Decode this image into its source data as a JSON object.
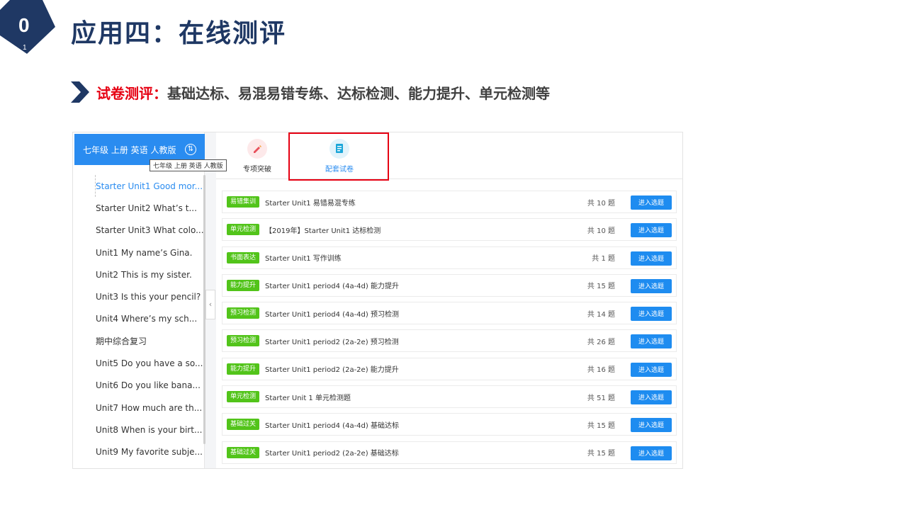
{
  "slide": {
    "badge_number": "0",
    "badge_sub": "1",
    "title": "应用四：在线测评",
    "subtitle_lead": "试卷测评：",
    "subtitle_rest": "基础达标、易混易错专练、达标检测、能力提升、单元检测等"
  },
  "sidebar": {
    "header": "七年级 上册 英语 人教版",
    "tooltip": "七年级 上册 英语 人教版",
    "items": [
      {
        "label": "Starter Unit1 Good mor..."
      },
      {
        "label": "Starter Unit2 What’s t..."
      },
      {
        "label": "Starter Unit3 What colo..."
      },
      {
        "label": "Unit1 My name’s Gina."
      },
      {
        "label": "Unit2 This is my sister."
      },
      {
        "label": "Unit3 Is this your pencil?"
      },
      {
        "label": "Unit4 Where’s my sch..."
      },
      {
        "label": "期中综合复习"
      },
      {
        "label": "Unit5 Do you have a so..."
      },
      {
        "label": "Unit6 Do you like bana..."
      },
      {
        "label": "Unit7 How much are th..."
      },
      {
        "label": "Unit8 When is your birt..."
      },
      {
        "label": "Unit9 My favorite subje..."
      }
    ]
  },
  "tabs": [
    {
      "label": "专项突破",
      "icon": "pencil-icon"
    },
    {
      "label": "配套试卷",
      "icon": "paper-icon"
    }
  ],
  "colors": {
    "accent": "#2a8cf0",
    "tag": "#52c41a",
    "highlight": "#e60012",
    "title": "#1f3864"
  },
  "papers": [
    {
      "tag": "易错集训",
      "title": "Starter Unit1 易错易混专练",
      "count": "共 10 题",
      "button": "进入选题"
    },
    {
      "tag": "单元检测",
      "title": "【2019年】Starter Unit1 达标检测",
      "count": "共 10 题",
      "button": "进入选题"
    },
    {
      "tag": "书面表达",
      "title": "Starter Unit1 写作训练",
      "count": "共 1 题",
      "button": "进入选题"
    },
    {
      "tag": "能力提升",
      "title": "Starter Unit1 period4 (4a-4d) 能力提升",
      "count": "共 15 题",
      "button": "进入选题"
    },
    {
      "tag": "预习检测",
      "title": "Starter Unit1 period4 (4a-4d) 预习检测",
      "count": "共 14 题",
      "button": "进入选题"
    },
    {
      "tag": "预习检测",
      "title": "Starter Unit1 period2 (2a-2e) 预习检测",
      "count": "共 26 题",
      "button": "进入选题"
    },
    {
      "tag": "能力提升",
      "title": "Starter Unit1 period2 (2a-2e) 能力提升",
      "count": "共 16 题",
      "button": "进入选题"
    },
    {
      "tag": "单元检测",
      "title": "Starter Unit 1 单元检测题",
      "count": "共 51 题",
      "button": "进入选题"
    },
    {
      "tag": "基础过关",
      "title": "Starter Unit1 period4 (4a-4d) 基础达标",
      "count": "共 15 题",
      "button": "进入选题"
    },
    {
      "tag": "基础过关",
      "title": "Starter Unit1 period2 (2a-2e) 基础达标",
      "count": "共 15 题",
      "button": "进入选题"
    }
  ]
}
